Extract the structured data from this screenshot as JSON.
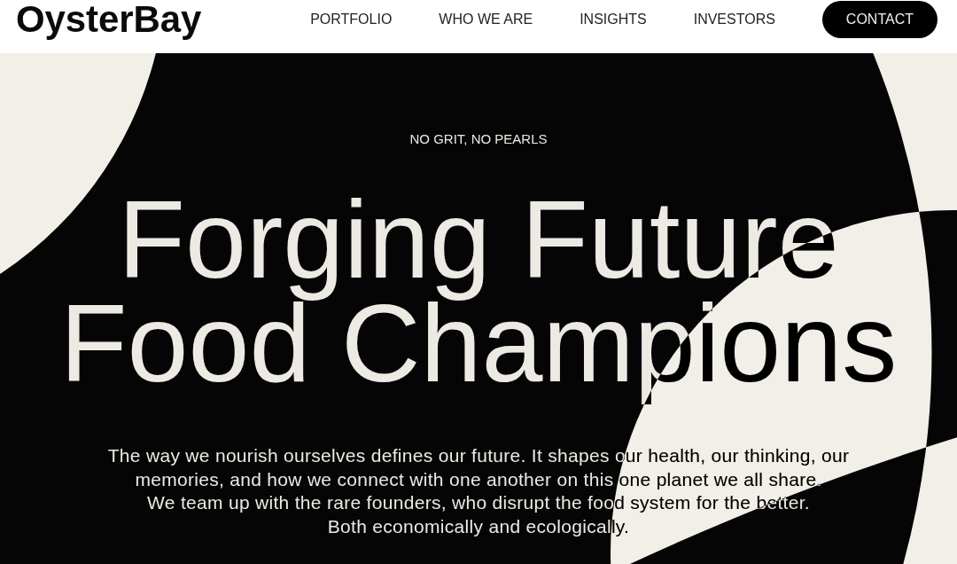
{
  "header": {
    "logo": "OysterBay",
    "nav_links": [
      {
        "label": "PORTFOLIO"
      },
      {
        "label": "WHO WE ARE"
      },
      {
        "label": "INSIGHTS"
      },
      {
        "label": "INVESTORS"
      }
    ],
    "contact_button": {
      "label": "CONTACT"
    }
  },
  "hero": {
    "tagline": "NO GRIT, NO PEARLS",
    "heading": "Forging Future Food Champions",
    "intro_lines": [
      "The way we nourish ourselves defines our future. It shapes our health, our thinking, our",
      "memories, and how we connect with one another on this one planet we all share.",
      "We team up with the rare founders, who disrupt the food system for the better.",
      "Both economically and ecologically."
    ]
  }
}
